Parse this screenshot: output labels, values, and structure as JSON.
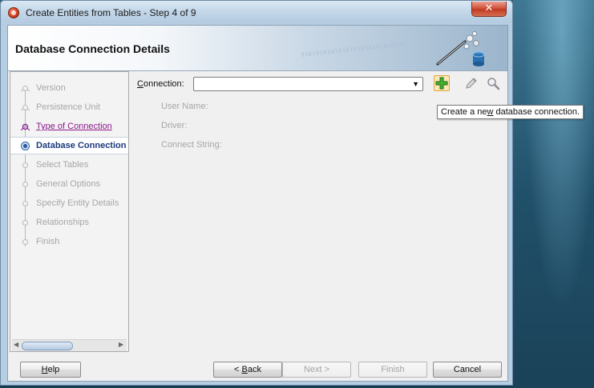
{
  "window": {
    "title": "Create Entities from Tables - Step 4 of 9",
    "close_glyph": "✕"
  },
  "header": {
    "title": "Database Connection Details",
    "binary_text": "0101010101010101010101010101"
  },
  "steps": [
    {
      "label": "Version",
      "state": "pending-done"
    },
    {
      "label": "Persistence Unit",
      "state": "pending-done"
    },
    {
      "label": "Type of Connection",
      "state": "visited"
    },
    {
      "label": "Database Connection",
      "state": "current"
    },
    {
      "label": "Select Tables",
      "state": "pending"
    },
    {
      "label": "General Options",
      "state": "pending"
    },
    {
      "label": "Specify Entity Details",
      "state": "pending"
    },
    {
      "label": "Relationships",
      "state": "pending"
    },
    {
      "label": "Finish",
      "state": "pending"
    }
  ],
  "form": {
    "connection_label_pre": "",
    "connection_label_accel": "C",
    "connection_label_post": "onnection:",
    "connection_value": "",
    "user_name_label": "User Name:",
    "driver_label": "Driver:",
    "connect_string_label": "Connect String:"
  },
  "tooltip": {
    "pre": "Create a ne",
    "accel": "w",
    "post": " database connection."
  },
  "buttons": {
    "help": {
      "accel": "H",
      "rest": "elp"
    },
    "back": {
      "pre": "< ",
      "accel": "B",
      "rest": "ack"
    },
    "next": "Next >",
    "finish": "Finish",
    "cancel": "Cancel"
  },
  "colors": {
    "visited_step": "#8b1b8b",
    "current_step": "#1a3a7c",
    "add_button_bg": "#fbe7b6",
    "titlebar": "#c2d6e8"
  }
}
